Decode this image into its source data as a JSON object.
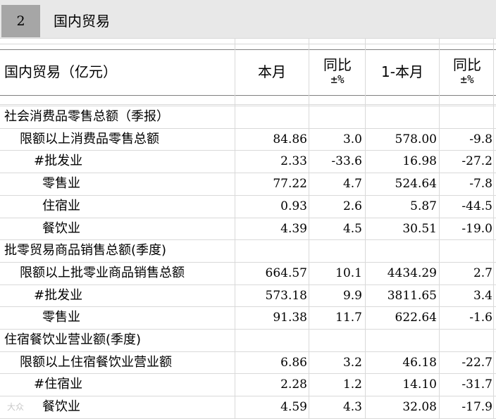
{
  "section": {
    "number": "2",
    "title": "国内贸易"
  },
  "columns": {
    "label": "国内贸易（亿元）",
    "month": "本月",
    "yoy1": "同比",
    "yoy1_unit": "±%",
    "ytd": "1-本月",
    "yoy2": "同比",
    "yoy2_unit": "±%"
  },
  "rows": [
    {
      "label": "社会消费品零售总额（季报）",
      "level": 0,
      "month": "",
      "yoy1": "",
      "ytd": "",
      "yoy2": ""
    },
    {
      "label": "限额以上消费品零售总额",
      "level": 1,
      "month": "84.86",
      "yoy1": "3.0",
      "ytd": "578.00",
      "yoy2": "-9.8"
    },
    {
      "label": "#批发业",
      "level": 2,
      "month": "2.33",
      "yoy1": "-33.6",
      "ytd": "16.98",
      "yoy2": "-27.2"
    },
    {
      "label": "零售业",
      "level": 3,
      "month": "77.22",
      "yoy1": "4.7",
      "ytd": "524.64",
      "yoy2": "-7.8"
    },
    {
      "label": "住宿业",
      "level": 3,
      "month": "0.93",
      "yoy1": "2.6",
      "ytd": "5.87",
      "yoy2": "-44.5"
    },
    {
      "label": "餐饮业",
      "level": 3,
      "month": "4.39",
      "yoy1": "4.5",
      "ytd": "30.51",
      "yoy2": "-19.0"
    },
    {
      "label": "批零贸易商品销售总额(季度)",
      "level": 0,
      "month": "",
      "yoy1": "",
      "ytd": "",
      "yoy2": ""
    },
    {
      "label": "限额以上批零业商品销售总额",
      "level": 1,
      "month": "664.57",
      "yoy1": "10.1",
      "ytd": "4434.29",
      "yoy2": "2.7"
    },
    {
      "label": "#批发业",
      "level": 2,
      "month": "573.18",
      "yoy1": "9.9",
      "ytd": "3811.65",
      "yoy2": "3.4"
    },
    {
      "label": "零售业",
      "level": 3,
      "month": "91.38",
      "yoy1": "11.7",
      "ytd": "622.64",
      "yoy2": "-1.6"
    },
    {
      "label": "住宿餐饮业营业额(季度)",
      "level": 0,
      "month": "",
      "yoy1": "",
      "ytd": "",
      "yoy2": ""
    },
    {
      "label": "限额以上住宿餐饮业营业额",
      "level": 1,
      "month": "6.86",
      "yoy1": "3.2",
      "ytd": "46.18",
      "yoy2": "-22.7"
    },
    {
      "label": "#住宿业",
      "level": 2,
      "month": "2.28",
      "yoy1": "1.2",
      "ytd": "14.10",
      "yoy2": "-31.7"
    },
    {
      "label": "餐饮业",
      "level": 3,
      "month": "4.59",
      "yoy1": "4.3",
      "ytd": "32.08",
      "yoy2": "-17.9"
    }
  ],
  "watermark": "大众"
}
